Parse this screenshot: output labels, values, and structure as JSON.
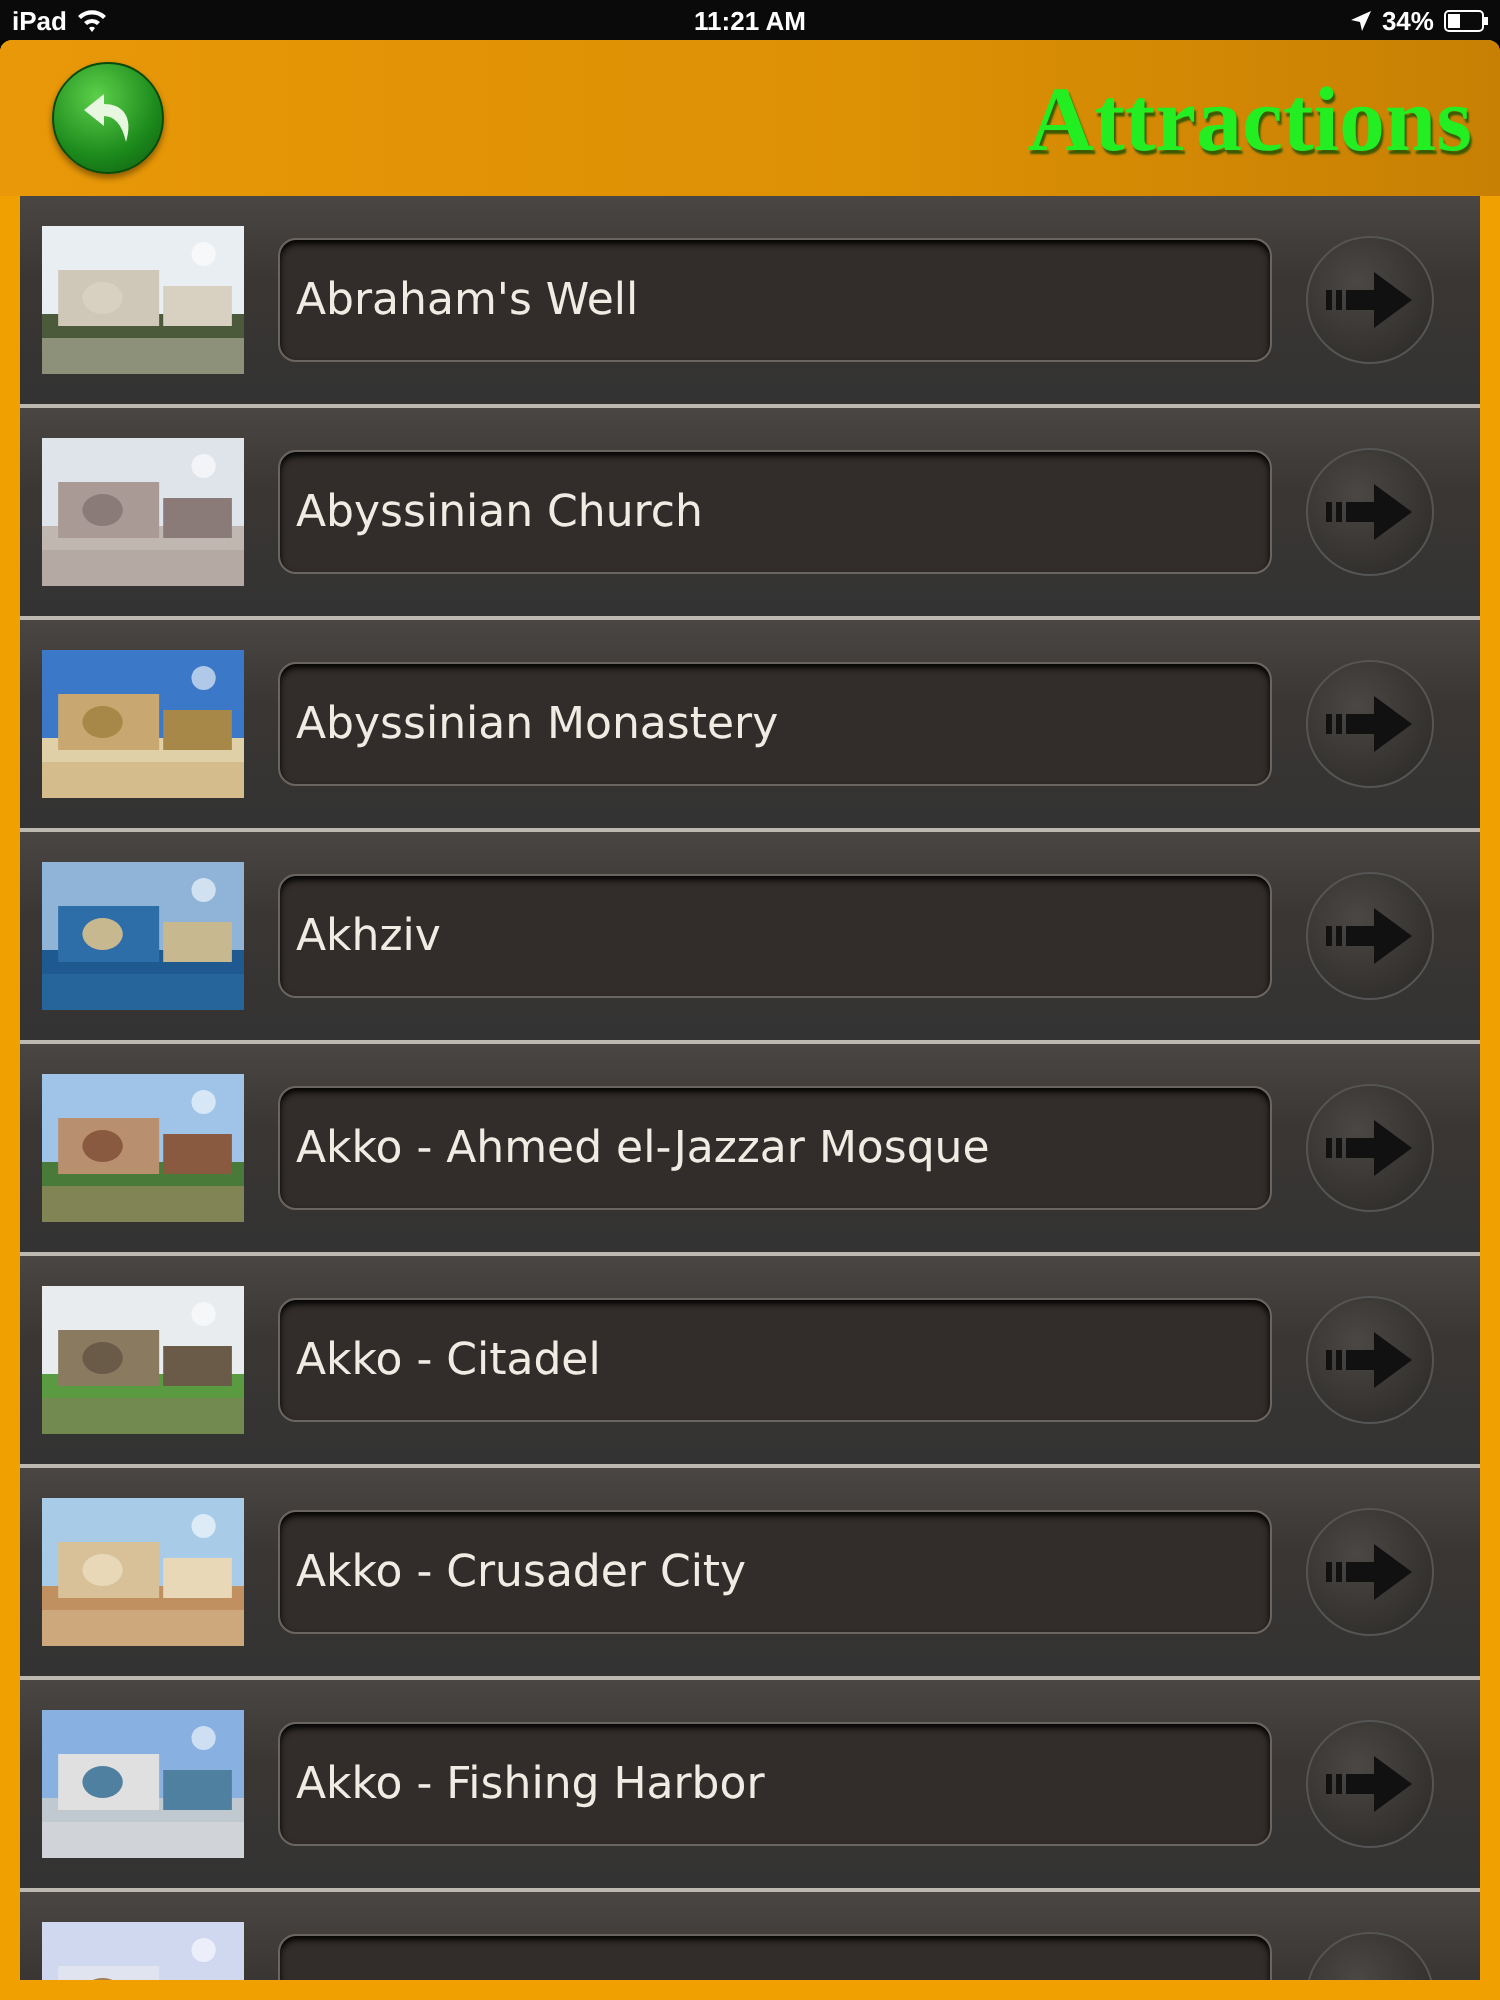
{
  "status_bar": {
    "carrier": "iPad",
    "time": "11:21 AM",
    "battery": "34%"
  },
  "header": {
    "title": "Attractions"
  },
  "rows": [
    {
      "title": "Abraham's Well",
      "thumbnail": {
        "kind": "picture"
      }
    },
    {
      "title": "Abyssinian Church",
      "thumbnail": {
        "kind": "picture"
      }
    },
    {
      "title": "Abyssinian Monastery",
      "thumbnail": {
        "kind": "picture"
      }
    },
    {
      "title": "Akhziv",
      "thumbnail": {
        "kind": "picture"
      }
    },
    {
      "title": "Akko - Ahmed el-Jazzar Mosque",
      "thumbnail": {
        "kind": "picture"
      }
    },
    {
      "title": "Akko - Citadel",
      "thumbnail": {
        "kind": "picture"
      }
    },
    {
      "title": "Akko - Crusader City",
      "thumbnail": {
        "kind": "picture"
      }
    },
    {
      "title": "Akko - Fishing Harbor",
      "thumbnail": {
        "kind": "picture"
      }
    },
    {
      "thumbnail": {
        "kind": "picture"
      }
    }
  ]
}
